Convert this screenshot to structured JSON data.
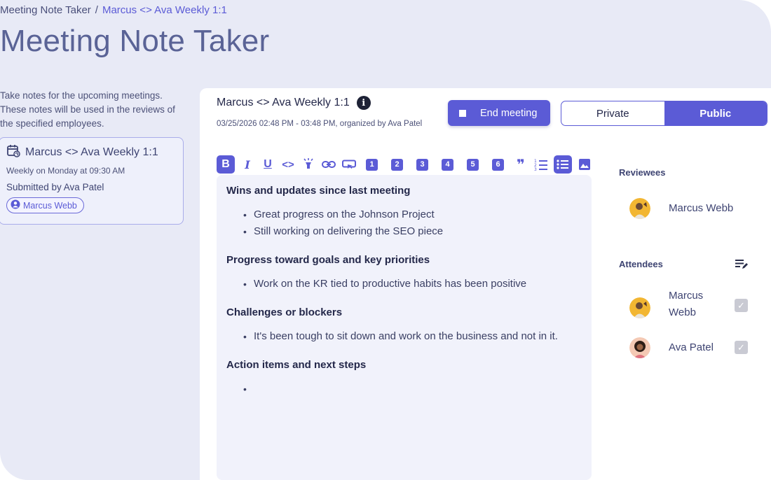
{
  "breadcrumb": {
    "root": "Meeting Note Taker",
    "separator": "/",
    "current": "Marcus <> Ava Weekly 1:1"
  },
  "page_title": "Meeting Note Taker",
  "intro_text": "Take notes for the upcoming meetings. These notes will be used in the reviews of the specified employees.",
  "meeting_card": {
    "icon": "calendar-repeat-icon",
    "title": "Marcus <> Ava Weekly 1:1",
    "schedule": "Weekly on Monday at 09:30 AM",
    "submitted_by": "Submitted by Ava Patel",
    "reviewee_chip": "Marcus Webb"
  },
  "meeting": {
    "title": "Marcus <> Ava Weekly 1:1",
    "meta": "03/25/2026 02:48 PM - 03:48 PM, organized by Ava Patel",
    "end_button": "End meeting",
    "visibility_options": [
      "Private",
      "Public"
    ],
    "visibility_selected": "Public"
  },
  "toolbar": {
    "bold": "B",
    "italic": "I",
    "underline": "U",
    "code": "<>",
    "h1": "1",
    "h2": "2",
    "h3": "3",
    "h4": "4",
    "h5": "5",
    "h6": "6",
    "quote": "❞"
  },
  "notes": {
    "sections": [
      {
        "heading": "Wins and updates since last meeting",
        "items": [
          "Great progress on the Johnson Project",
          "Still working on delivering the SEO piece"
        ]
      },
      {
        "heading": "Progress toward goals and key priorities",
        "items": [
          "Work on the KR tied to productive habits has been positive"
        ]
      },
      {
        "heading": "Challenges or blockers",
        "items": [
          "It's been tough to sit down and work on the business and not in it."
        ]
      },
      {
        "heading": "Action items and next steps",
        "items": [
          ""
        ]
      }
    ]
  },
  "reviewees": {
    "label": "Reviewees",
    "people": [
      {
        "name": "Marcus Webb"
      }
    ]
  },
  "attendees": {
    "label": "Attendees",
    "people": [
      {
        "name_line1": "Marcus",
        "name_line2": "Webb",
        "checked": true
      },
      {
        "name": "Ava Patel",
        "checked": true
      }
    ]
  },
  "colors": {
    "accent": "#5b5bd6",
    "page_bg": "#e8eaf6",
    "editor_bg": "#f1f2fb",
    "checkbox": "#c9cad3"
  }
}
